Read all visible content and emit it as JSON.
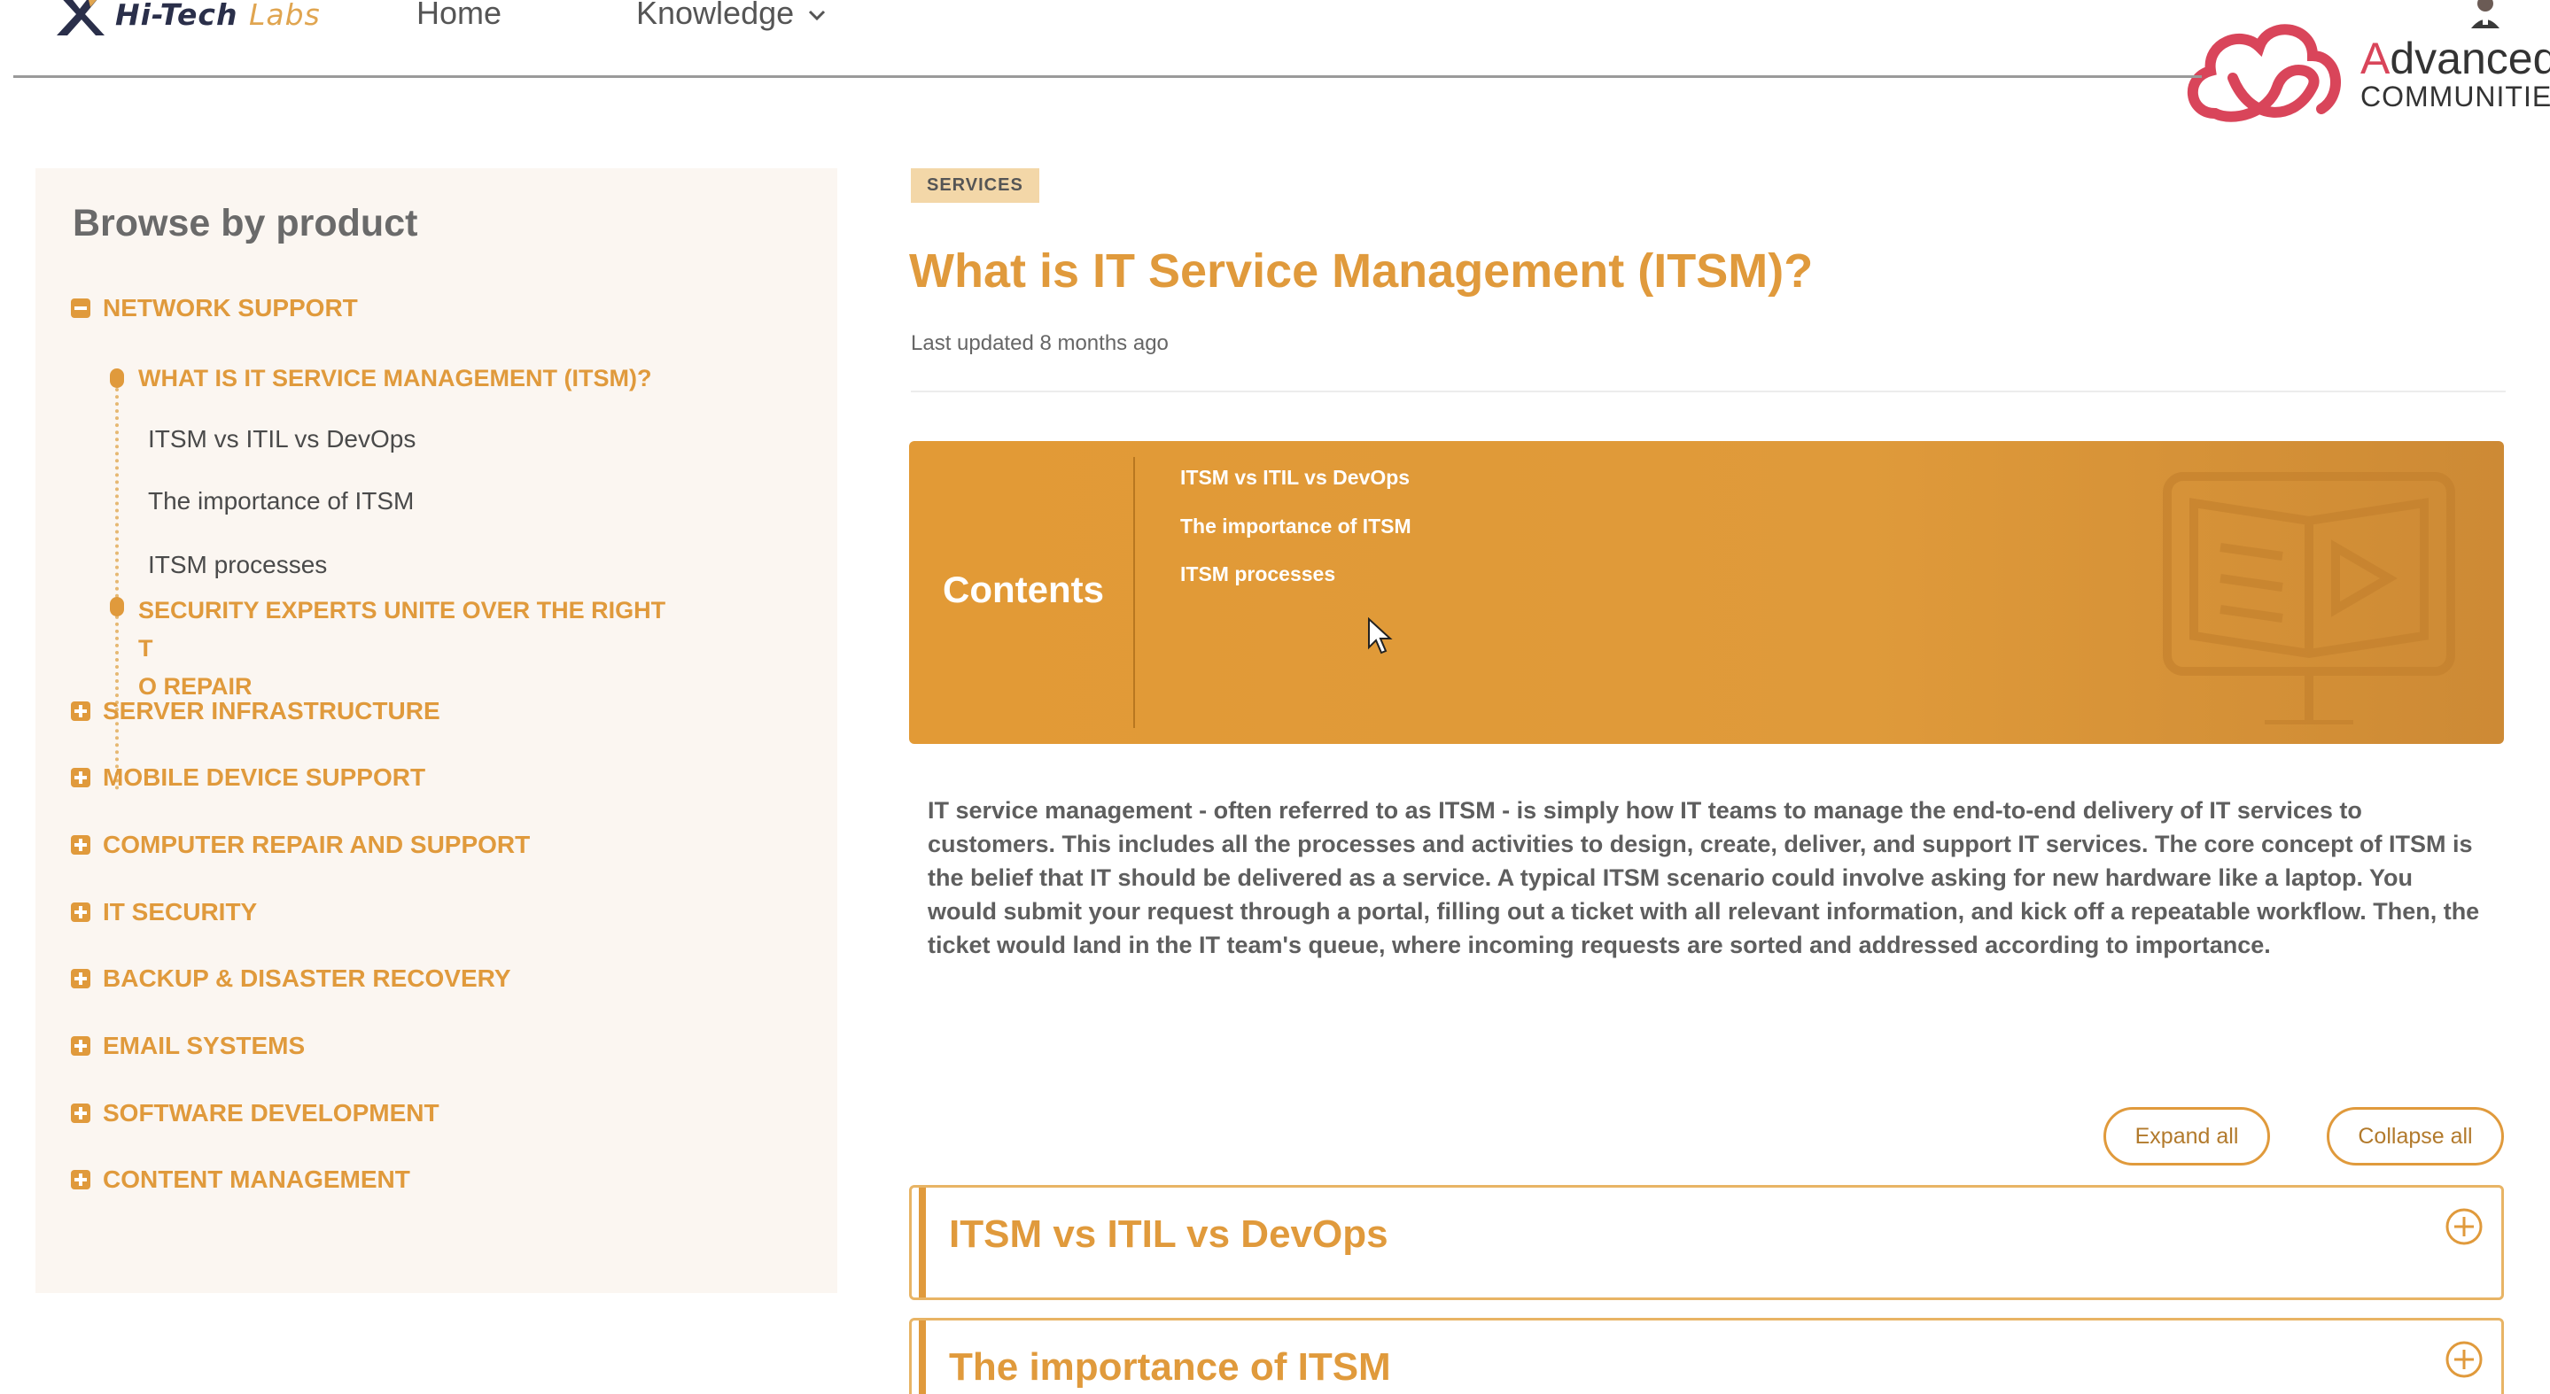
{
  "header": {
    "logo_name": "Hi-Tech",
    "logo_suffix": "Labs",
    "nav": [
      {
        "label": "Home"
      },
      {
        "label": "Knowledge"
      }
    ],
    "brand_line1_initial": "A",
    "brand_line1_rest": "dvanced",
    "brand_line2": "COMMUNITIES"
  },
  "sidebar": {
    "title": "Browse by product",
    "expanded_category": "NETWORK SUPPORT",
    "current_article": "WHAT IS IT SERVICE MANAGEMENT (ITSM)?",
    "current_sections": [
      "ITSM vs ITIL vs DevOps",
      "The importance of ITSM",
      "ITSM processes"
    ],
    "next_article_line1": "SECURITY EXPERTS UNITE OVER THE RIGHT T",
    "next_article_line2": "O REPAIR",
    "categories": [
      "SERVER INFRASTRUCTURE",
      "MOBILE DEVICE SUPPORT",
      "COMPUTER REPAIR AND SUPPORT",
      "IT SECURITY",
      "BACKUP & DISASTER RECOVERY",
      "EMAIL SYSTEMS",
      "SOFTWARE DEVELOPMENT",
      "CONTENT MANAGEMENT"
    ]
  },
  "article": {
    "badge": "SERVICES",
    "title": "What is IT Service Management (ITSM)?",
    "updated": "Last updated 8 months ago",
    "contents_title": "Contents",
    "contents_links": [
      "ITSM vs ITIL vs DevOps",
      "The importance of ITSM",
      "ITSM processes"
    ],
    "body": "IT service management - often referred to as ITSM - is simply how IT teams to manage the end-to-end delivery of IT services to customers. This includes all the processes and activities to design, create, deliver, and support IT services. The core concept of ITSM is the belief that IT should be delivered as a service. A typical ITSM scenario could involve asking for new hardware like a laptop. You would submit your request through a portal, filling out a ticket with all relevant information, and kick off a repeatable workflow. Then, the ticket would land in the IT team's queue, where incoming requests are sorted and addressed according to importance.",
    "expand_label": "Expand all",
    "collapse_label": "Collapse all",
    "sections": [
      "ITSM vs ITIL vs DevOps",
      "The importance of ITSM"
    ]
  },
  "colors": {
    "accent": "#e09a3c",
    "badge_bg": "#f3d7a8",
    "sidebar_bg": "#fbf6f1",
    "brand_red": "#d9455a"
  },
  "icons": [
    "hi-tech-logo-icon",
    "chevron-down-icon",
    "avatar-icon",
    "advanced-communities-cloud-icon",
    "minus-square-icon",
    "plus-square-icon",
    "book-monitor-icon",
    "mouse-cursor-icon",
    "plus-circle-icon"
  ]
}
